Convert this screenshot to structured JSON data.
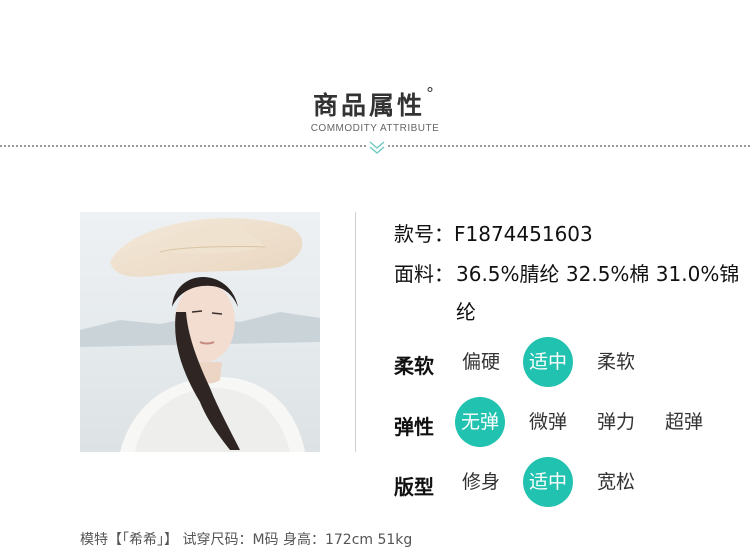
{
  "header": {
    "title": "商品属性",
    "title_mark": "°",
    "subtitle": "COMMODITY ATTRIBUTE"
  },
  "info": {
    "style_label": "款号：",
    "style_value": "F1874451603",
    "fabric_label": "面料：",
    "fabric_value": "36.5%腈纶 32.5%棉 31.0%锦纶"
  },
  "attributes": [
    {
      "label": "柔软",
      "options": [
        "偏硬",
        "适中",
        "柔软"
      ],
      "selected": "适中"
    },
    {
      "label": "弹性",
      "options": [
        "无弹",
        "微弹",
        "弹力",
        "超弹"
      ],
      "selected": "无弹"
    },
    {
      "label": "版型",
      "options": [
        "修身",
        "适中",
        "宽松"
      ],
      "selected": "适中"
    }
  ],
  "footer": {
    "text": "模特【「希希」】 试穿尺码：M码 身高：172cm 51kg"
  },
  "colors": {
    "accent": "#22c2b0",
    "chevron": "#6fc9c0"
  }
}
